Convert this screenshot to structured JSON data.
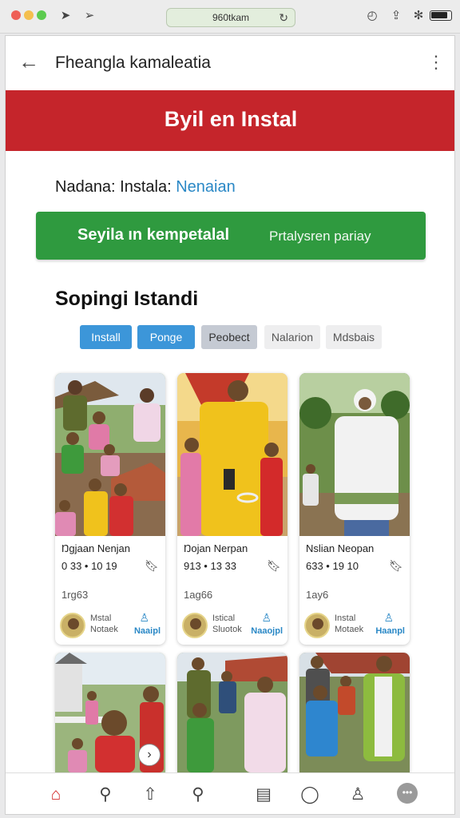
{
  "browser": {
    "address": "960tkam"
  },
  "appbar": {
    "title": "Fheangla kamaleatia"
  },
  "banner": {
    "text": "Byil en Instal"
  },
  "status": {
    "prefix": "Nadana:  Instala:",
    "value": "Nenaian",
    "accent_color": "#2a88c6"
  },
  "cta": {
    "main": "Seyila ın kempetalal",
    "sub": "Prtalysren pariay",
    "color": "#2f9a3f"
  },
  "section": {
    "title": "Sopingi Istandi"
  },
  "chips": [
    "Install",
    "Ponge",
    "Peobect",
    "Nalarion",
    "Mdsbais"
  ],
  "cards": [
    {
      "title": "Ŋgjaan Nenjan",
      "stats": "0 33 • 10   19",
      "count": "1rg63",
      "seller_line1": "Mstal",
      "seller_line2": "Notaek",
      "follow": "Naaipl"
    },
    {
      "title": "Ŋojan Nerpan",
      "stats": "913 • 13   33",
      "count": "1ag66",
      "seller_line1": "Istical",
      "seller_line2": "Sluotok",
      "follow": "Naaojpl"
    },
    {
      "title": "Nslian Neopan",
      "stats": "633 • 19   10",
      "count": "1ay6",
      "seller_line1": "Instal",
      "seller_line2": "Motaek",
      "follow": "Haanpl"
    }
  ],
  "icons": {
    "back": "arrow-left-icon",
    "more": "kebab-menu-icon",
    "bookmark": "bookmark-icon",
    "follow": "user-icon"
  },
  "brand_colors": {
    "banner": "#c5252b",
    "chip_active": "#3c96d9"
  }
}
